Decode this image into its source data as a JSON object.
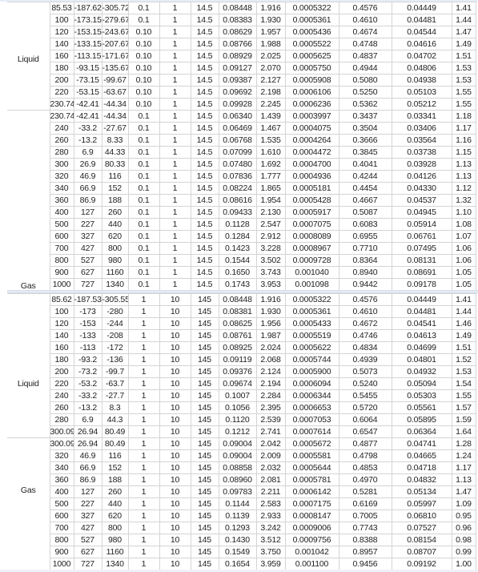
{
  "blocks": [
    {
      "groups": [
        {
          "label": "Liquid",
          "rows": [
            [
              "85.53",
              "-187.62",
              "-305.72",
              "0.1",
              "1",
              "14.5",
              "0.08448",
              "1.916",
              "0.0005322",
              "0.4576",
              "0.04449",
              "1.41"
            ],
            [
              "100",
              "-173.15",
              "-279.67",
              "0.1",
              "1",
              "14.5",
              "0.08383",
              "1.930",
              "0.0005361",
              "0.4610",
              "0.04481",
              "1.44"
            ],
            [
              "120",
              "-153.15",
              "-243.67",
              "0.10",
              "1",
              "14.5",
              "0.08629",
              "1.957",
              "0.0005436",
              "0.4674",
              "0.04544",
              "1.47"
            ],
            [
              "140",
              "-133.15",
              "-207.67",
              "0.10",
              "1",
              "14.5",
              "0.08766",
              "1.988",
              "0.0005522",
              "0.4748",
              "0.04616",
              "1.49"
            ],
            [
              "160",
              "-113.15",
              "-171.67",
              "0.10",
              "1",
              "14.5",
              "0.08929",
              "2.025",
              "0.0005625",
              "0.4837",
              "0.04702",
              "1.51"
            ],
            [
              "180",
              "-93.15",
              "-135.67",
              "0.10",
              "1",
              "14.5",
              "0.09127",
              "2.070",
              "0.0005750",
              "0.4944",
              "0.04806",
              "1.53"
            ],
            [
              "200",
              "-73.15",
              "-99.67",
              "0.10",
              "1",
              "14.5",
              "0.09387",
              "2.127",
              "0.0005908",
              "0.5080",
              "0.04938",
              "1.53"
            ],
            [
              "220",
              "-53.15",
              "-63.67",
              "0.10",
              "1",
              "14.5",
              "0.09692",
              "2.198",
              "0.0006106",
              "0.5250",
              "0.05103",
              "1.55"
            ],
            [
              "230.74",
              "-42.41",
              "-44.34",
              "0.10",
              "1",
              "14.5",
              "0.09928",
              "2.245",
              "0.0006236",
              "0.5362",
              "0.05212",
              "1.55"
            ]
          ]
        },
        {
          "label": "Gas",
          "rows": [
            [
              "230.74",
              "-42.41",
              "-44.34",
              "0.1",
              "1",
              "14.5",
              "0.06340",
              "1.439",
              "0.0003997",
              "0.3437",
              "0.03341",
              "1.18"
            ],
            [
              "240",
              "-33.2",
              "-27.67",
              "0.1",
              "1",
              "14.5",
              "0.06469",
              "1.467",
              "0.0004075",
              "0.3504",
              "0.03406",
              "1.17"
            ],
            [
              "260",
              "-13.2",
              "8.33",
              "0.1",
              "1",
              "14.5",
              "0.06768",
              "1.535",
              "0.0004264",
              "0.3666",
              "0.03564",
              "1.16"
            ],
            [
              "280",
              "6.9",
              "44.33",
              "0.1",
              "1",
              "14.5",
              "0.07099",
              "1.610",
              "0.0004472",
              "0.3845",
              "0.03738",
              "1.15"
            ],
            [
              "300",
              "26.9",
              "80.33",
              "0.1",
              "1",
              "14.5",
              "0.07480",
              "1.692",
              "0.0004700",
              "0.4041",
              "0.03928",
              "1.13"
            ],
            [
              "320",
              "46.9",
              "116",
              "0.1",
              "1",
              "14.5",
              "0.07836",
              "1.777",
              "0.0004936",
              "0.4244",
              "0.04126",
              "1.13"
            ],
            [
              "340",
              "66.9",
              "152",
              "0.1",
              "1",
              "14.5",
              "0.08224",
              "1.865",
              "0.0005181",
              "0.4454",
              "0.04330",
              "1.12"
            ],
            [
              "360",
              "86.9",
              "188",
              "0.1",
              "1",
              "14.5",
              "0.08616",
              "1.954",
              "0.0005428",
              "0.4667",
              "0.04537",
              "1.32"
            ],
            [
              "400",
              "127",
              "260",
              "0.1",
              "1",
              "14.5",
              "0.09433",
              "2.130",
              "0.0005917",
              "0.5087",
              "0.04945",
              "1.10"
            ],
            [
              "500",
              "227",
              "440",
              "0.1",
              "1",
              "14.5",
              "0.1128",
              "2.547",
              "0.0007075",
              "0.6083",
              "0.05914",
              "1.08"
            ],
            [
              "600",
              "327",
              "620",
              "0.1",
              "1",
              "14.5",
              "0.1284",
              "2.912",
              "0.0008089",
              "0.6955",
              "0.06761",
              "1.07"
            ],
            [
              "700",
              "427",
              "800",
              "0.1",
              "1",
              "14.5",
              "0.1423",
              "3.228",
              "0.0008967",
              "0.7710",
              "0.07495",
              "1.06"
            ],
            [
              "800",
              "527",
              "980",
              "0.1",
              "1",
              "14.5",
              "0.1544",
              "3.502",
              "0.0009728",
              "0.8364",
              "0.08131",
              "1.06"
            ],
            [
              "900",
              "627",
              "1160",
              "0.1",
              "1",
              "14.5",
              "0.1650",
              "3.743",
              "0.001040",
              "0.8940",
              "0.08691",
              "1.05"
            ],
            [
              "1000",
              "727",
              "1340",
              "0.1",
              "1",
              "14.5",
              "0.1743",
              "3.953",
              "0.001098",
              "0.9442",
              "0.09178",
              "1.05"
            ]
          ]
        }
      ]
    },
    {
      "groups": [
        {
          "label": "Liquid",
          "rows": [
            [
              "85.62",
              "-187.53",
              "-305.55",
              "1",
              "10",
              "145",
              "0.08448",
              "1.916",
              "0.0005322",
              "0.4576",
              "0.04449",
              "1.41"
            ],
            [
              "100",
              "-173",
              "-280",
              "1",
              "10",
              "145",
              "0.08381",
              "1.930",
              "0.0005361",
              "0.4610",
              "0.04481",
              "1.44"
            ],
            [
              "120",
              "-153",
              "-244",
              "1",
              "10",
              "145",
              "0.08625",
              "1.956",
              "0.0005433",
              "0.4672",
              "0.04541",
              "1.46"
            ],
            [
              "140",
              "-133",
              "-208",
              "1",
              "10",
              "145",
              "0.08761",
              "1.987",
              "0.0005519",
              "0.4746",
              "0.04613",
              "1.49"
            ],
            [
              "160",
              "-113",
              "-172",
              "1",
              "10",
              "145",
              "0.08925",
              "2.024",
              "0.0005622",
              "0.4834",
              "0.04699",
              "1.51"
            ],
            [
              "180",
              "-93.2",
              "-136",
              "1",
              "10",
              "145",
              "0.09119",
              "2.068",
              "0.0005744",
              "0.4939",
              "0.04801",
              "1.52"
            ],
            [
              "200",
              "-73.2",
              "-99.7",
              "1",
              "10",
              "145",
              "0.09376",
              "2.124",
              "0.0005900",
              "0.5073",
              "0.04932",
              "1.53"
            ],
            [
              "220",
              "-53.2",
              "-63.7",
              "1",
              "10",
              "145",
              "0.09674",
              "2.194",
              "0.0006094",
              "0.5240",
              "0.05094",
              "1.54"
            ],
            [
              "240",
              "-33.2",
              "-27.7",
              "1",
              "10",
              "145",
              "0.1007",
              "2.284",
              "0.0006344",
              "0.5455",
              "0.05303",
              "1.55"
            ],
            [
              "260",
              "-13.2",
              "8.3",
              "1",
              "10",
              "145",
              "0.1056",
              "2.395",
              "0.0006653",
              "0.5720",
              "0.05561",
              "1.57"
            ],
            [
              "280",
              "6.9",
              "44.3",
              "1",
              "10",
              "145",
              "0.1120",
              "2.539",
              "0.0007053",
              "0.6064",
              "0.05895",
              "1.59"
            ],
            [
              "300.09",
              "26.94",
              "80.49",
              "1",
              "10",
              "145",
              "0.1212",
              "2.741",
              "0.0007614",
              "0.6547",
              "0.06364",
              "1.64"
            ]
          ]
        },
        {
          "label": "Gas",
          "rows": [
            [
              "300.09",
              "26.94",
              "80.49",
              "1",
              "10",
              "145",
              "0.09004",
              "2.042",
              "0.0005672",
              "0.4877",
              "0.04741",
              "1.28"
            ],
            [
              "320",
              "46.9",
              "116",
              "1",
              "10",
              "145",
              "0.09004",
              "2.009",
              "0.0005581",
              "0.4798",
              "0.04665",
              "1.24"
            ],
            [
              "340",
              "66.9",
              "152",
              "1",
              "10",
              "145",
              "0.08858",
              "2.032",
              "0.0005644",
              "0.4853",
              "0.04718",
              "1.17"
            ],
            [
              "360",
              "86.9",
              "188",
              "1",
              "10",
              "145",
              "0.08960",
              "2.081",
              "0.0005781",
              "0.4970",
              "0.04832",
              "1.13"
            ],
            [
              "400",
              "127",
              "260",
              "1",
              "10",
              "145",
              "0.09783",
              "2.211",
              "0.0006142",
              "0.5281",
              "0.05134",
              "1.47"
            ],
            [
              "500",
              "227",
              "440",
              "1",
              "10",
              "145",
              "0.1144",
              "2.583",
              "0.0007175",
              "0.6169",
              "0.05997",
              "1.09"
            ],
            [
              "600",
              "327",
              "620",
              "1",
              "10",
              "145",
              "0.1139",
              "2.933",
              "0.0008147",
              "0.7005",
              "0.06810",
              "0.95"
            ],
            [
              "700",
              "427",
              "800",
              "1",
              "10",
              "145",
              "0.1293",
              "3.242",
              "0.0009006",
              "0.7743",
              "0.07527",
              "0.96"
            ],
            [
              "800",
              "527",
              "980",
              "1",
              "10",
              "145",
              "0.1430",
              "3.512",
              "0.0009756",
              "0.8388",
              "0.08154",
              "0.98"
            ],
            [
              "900",
              "627",
              "1160",
              "1",
              "10",
              "145",
              "0.1549",
              "3.750",
              "0.001042",
              "0.8957",
              "0.08707",
              "0.99"
            ],
            [
              "1000",
              "727",
              "1340",
              "1",
              "10",
              "145",
              "0.1654",
              "3.959",
              "0.001100",
              "0.9456",
              "0.09192",
              "1.00"
            ]
          ]
        }
      ]
    }
  ]
}
